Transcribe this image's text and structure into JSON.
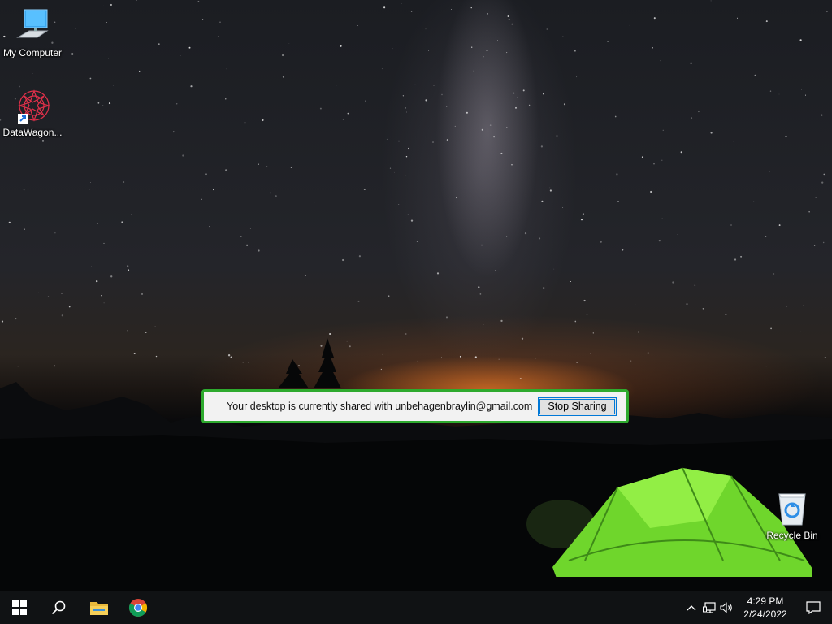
{
  "desktop": {
    "icons": [
      {
        "label": "My Computer",
        "icon": "computer-icon"
      },
      {
        "label": "DataWagon...",
        "icon": "datawagon-icon"
      },
      {
        "label": "Recycle Bin",
        "icon": "recycle-bin-icon"
      }
    ]
  },
  "share_banner": {
    "message": "Your desktop is currently shared with unbehagenbraylin@gmail.com",
    "stop_label": "Stop Sharing",
    "border_color": "#2eaa2e"
  },
  "taskbar": {
    "buttons": [
      {
        "icon": "windows-start-icon"
      },
      {
        "icon": "search-icon"
      },
      {
        "icon": "file-explorer-icon"
      },
      {
        "icon": "chrome-icon"
      }
    ],
    "tray": {
      "icons": [
        "chevron-up-icon",
        "network-icon",
        "volume-icon"
      ],
      "time": "4:29 PM",
      "date": "2/24/2022",
      "notification_icon": "notification-icon"
    }
  }
}
